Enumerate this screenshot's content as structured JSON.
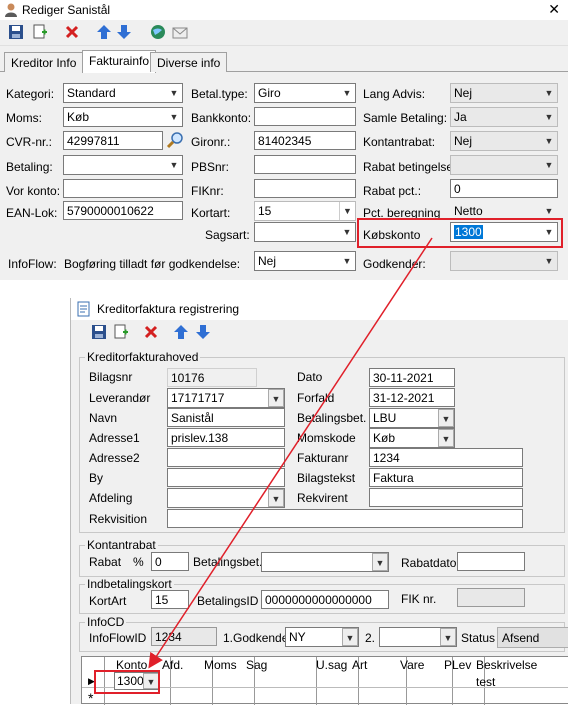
{
  "window1": {
    "title": "Rediger Sanistål",
    "close": "✕",
    "tabs": [
      "Kreditor Info",
      "Fakturainfo",
      "Diverse info"
    ],
    "left": {
      "kategori_label": "Kategori:",
      "kategori_value": "Standard",
      "moms_label": "Moms:",
      "moms_value": "Køb",
      "cvr_label": "CVR-nr.:",
      "cvr_value": "42997811",
      "betaling_label": "Betaling:",
      "betaling_value": "",
      "vorkonto_label": "Vor konto:",
      "vorkonto_value": "",
      "ean_label": "EAN-Lok:",
      "ean_value": "5790000010622"
    },
    "middle": {
      "betaltype_label": "Betal.type:",
      "betaltype_value": "Giro",
      "bankkonto_label": "Bankkonto:",
      "bankkonto_value": "",
      "gironr_label": "Gironr.:",
      "gironr_value": "81402345",
      "pbsnr_label": "PBSnr:",
      "pbsnr_value": "",
      "fiknr_label": "FIKnr:",
      "fiknr_value": "",
      "kortart_label": "Kortart:",
      "kortart_value": "15",
      "sagsart_label": "Sagsart:",
      "sagsart_value": ""
    },
    "right": {
      "langadvis_label": "Lang Advis:",
      "langadvis_value": "Nej",
      "samle_label": "Samle Betaling:",
      "samle_value": "Ja",
      "kontantrabat_label": "Kontantrabat:",
      "kontantrabat_value": "Nej",
      "rabatbet_label": "Rabat betingelse:",
      "rabatbet_value": "",
      "rabatpct_label": "Rabat pct.:",
      "rabatpct_value": "0",
      "pctberegning_label": "Pct. beregning",
      "pctberegning_value": "Netto",
      "kobskonto_label": "Købskonto",
      "kobskonto_value": "1300",
      "godkender_label": "Godkender:",
      "godkender_value": ""
    },
    "infoflow_label": "InfoFlow:",
    "bogforing_label": "Bogføring tilladt før godkendelse:",
    "bogforing_value": "Nej",
    "accent_red": "#e0202a"
  },
  "window2": {
    "title": "Kreditorfaktura registrering",
    "hoved_title": "Kreditorfakturahoved",
    "bilagsnr_label": "Bilagsnr",
    "bilagsnr_value": "10176",
    "leverandor_label": "Leverandør",
    "leverandor_value": "17171717",
    "navn_label": "Navn",
    "navn_value": "Sanistål",
    "adresse1_label": "Adresse1",
    "adresse1_value": "prislev.138",
    "adresse2_label": "Adresse2",
    "adresse2_value": "",
    "by_label": "By",
    "by_value": "",
    "afdeling_label": "Afdeling",
    "afdeling_value": "",
    "rekvisition_label": "Rekvisition",
    "rekvisition_value": "",
    "dato_label": "Dato",
    "dato_value": "30-11-2021",
    "forfald_label": "Forfald",
    "forfald_value": "31-12-2021",
    "betalingsbet_label": "Betalingsbet.",
    "betalingsbet_value": "LBU",
    "momskode_label": "Momskode",
    "momskode_value": "Køb",
    "fakturanr_label": "Fakturanr",
    "fakturanr_value": "1234",
    "bilagstekst_label": "Bilagstekst",
    "bilagstekst_value": "Faktura",
    "rekvirent_label": "Rekvirent",
    "rekvirent_value": "",
    "kontantrabat_title": "Kontantrabat",
    "rabat_label": "Rabat",
    "pct_sign": "%",
    "rabat_value": "0",
    "k_betalingsbet_label": "Betalingsbet.",
    "k_betalingsbet_value": "",
    "rabatdato_label": "Rabatdato",
    "rabatdato_value": "",
    "indbetaling_title": "Indbetalingskort",
    "kortart_label": "KortArt",
    "kortart_value": "15",
    "betalingsid_label": "BetalingsID",
    "betalingsid_value": "0000000000000000",
    "fiknr_label": "FIK nr.",
    "fiknr_value": "",
    "infocd_title": "InfoCD",
    "infoflowid_label": "InfoFlowID",
    "infoflowid_value": "1234",
    "godkender1_label": "1.Godkender",
    "godkender1_value": "NY",
    "godkender2_label": "2.",
    "godkender2_value": "",
    "status_label": "Status",
    "afsend_label": "Afsend",
    "grid_headers": [
      "Konto",
      "Afd.",
      "Moms",
      "Sag",
      "U.sag",
      "Art",
      "Vare",
      "PLev",
      "Beskrivelse"
    ],
    "row_konto": "1300",
    "row_beskrivelse": "test",
    "row_marker": "▶",
    "new_row_marker": "*"
  }
}
